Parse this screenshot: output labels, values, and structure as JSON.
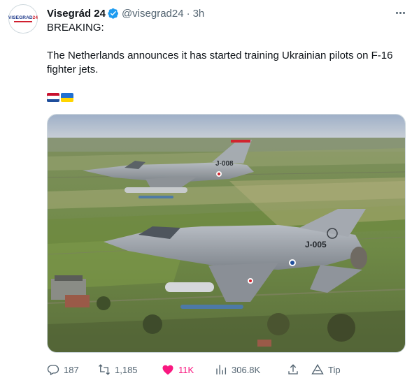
{
  "author": {
    "avatar_text_a": "VISEGRAD",
    "avatar_text_b": "24",
    "name": "Visegrád 24",
    "handle": "@visegrad24",
    "separator": "·",
    "time": "3h"
  },
  "tweet": {
    "line1": "BREAKING:",
    "line2": "The Netherlands announces it has started training Ukrainian pilots on F-16 fighter jets.",
    "flags": [
      "netherlands-flag",
      "ukraine-flag"
    ]
  },
  "image": {
    "tail_code_rear": "J-008",
    "tail_code_front": "J-005"
  },
  "actions": {
    "replies": "187",
    "retweets": "1,185",
    "likes": "11K",
    "views": "306.8K",
    "tip_label": "Tip"
  },
  "colors": {
    "like_pink": "#f91880",
    "verified_blue": "#1d9bf0",
    "secondary_text": "#536471"
  }
}
